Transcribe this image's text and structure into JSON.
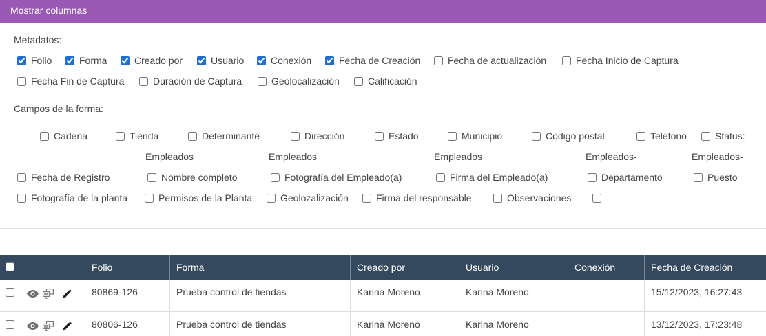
{
  "panel": {
    "title": "Mostrar columnas",
    "metadata": {
      "label": "Metadatos:",
      "options": [
        {
          "label": "Folio",
          "checked": true
        },
        {
          "label": "Forma",
          "checked": true
        },
        {
          "label": "Creado por",
          "checked": true
        },
        {
          "label": "Usuario",
          "checked": true
        },
        {
          "label": "Conexión",
          "checked": true
        },
        {
          "label": "Fecha de Creación",
          "checked": true
        },
        {
          "label": "Fecha de actualización",
          "checked": false
        },
        {
          "label": "Fecha Inicio de Captura",
          "checked": false
        },
        {
          "label": "Fecha Fin de Captura",
          "checked": false
        },
        {
          "label": "Duración de Captura",
          "checked": false
        },
        {
          "label": "Geolocalización",
          "checked": false
        },
        {
          "label": "Calificación",
          "checked": false
        }
      ]
    },
    "form_fields": {
      "label": "Campos de la forma:",
      "options": [
        {
          "label": "Cadena",
          "checked": false
        },
        {
          "label": "Tienda",
          "checked": false
        },
        {
          "label": "Determinante",
          "checked": false
        },
        {
          "label": "Dirección",
          "checked": false
        },
        {
          "label": "Estado",
          "checked": false
        },
        {
          "label": "Municipio",
          "checked": false
        },
        {
          "label": "Código postal",
          "checked": false
        },
        {
          "label": "Teléfono",
          "checked": false
        },
        {
          "label": "Status:",
          "checked": false
        },
        {
          "label": "Fecha de Registro",
          "checked": false
        },
        {
          "group": "Empleados",
          "label": "Nombre completo",
          "checked": false
        },
        {
          "group": "Empleados",
          "label": "Fotografía del Empleado(a)",
          "checked": false
        },
        {
          "group": "Empleados",
          "label": "Firma del Empleado(a)",
          "checked": false
        },
        {
          "group": "Empleados-",
          "label": "Departamento",
          "checked": false
        },
        {
          "group": "Empleados-",
          "label": "Puesto",
          "checked": false
        },
        {
          "label": "Fotografía de la planta",
          "checked": false
        },
        {
          "label": "Permisos de la Planta",
          "checked": false
        },
        {
          "label": "Geolozalización",
          "checked": false
        },
        {
          "label": "Firma del responsable",
          "checked": false
        },
        {
          "label": "Observaciones",
          "checked": false
        },
        {
          "checked": false
        }
      ]
    }
  },
  "table": {
    "select_all_checked": false,
    "columns": [
      "Folio",
      "Forma",
      "Creado por",
      "Usuario",
      "Conexión",
      "Fecha de Creación"
    ],
    "row_actions": [
      "eye-icon",
      "desktop-icon",
      "pencil-icon"
    ],
    "rows": [
      {
        "checked": false,
        "folio": "80869-126",
        "forma": "Prueba control de tiendas",
        "creado_por": "Karina Moreno",
        "usuario": "Karina Moreno",
        "conexion": "",
        "fecha_creacion": "15/12/2023, 16:27:43"
      },
      {
        "checked": false,
        "folio": "80806-126",
        "forma": "Prueba control de tiendas",
        "creado_por": "Karina Moreno",
        "usuario": "Karina Moreno",
        "conexion": "",
        "fecha_creacion": "13/12/2023, 17:23:48"
      }
    ]
  },
  "colors": {
    "header_bar": "#9b59b6",
    "table_header": "#34495e",
    "checkbox_checked": "#1f6fd1"
  }
}
